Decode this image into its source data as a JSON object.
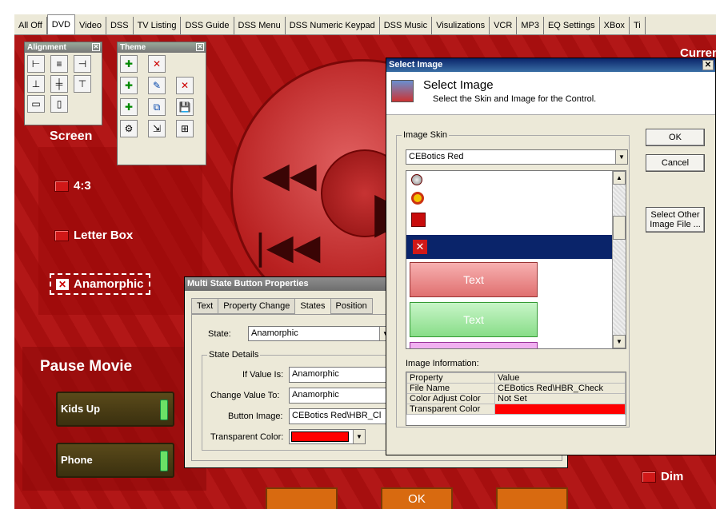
{
  "tabs": [
    "All Off",
    "DVD",
    "Video",
    "DSS",
    "TV Listing",
    "DSS Guide",
    "DSS Menu",
    "DSS Numeric Keypad",
    "DSS Music",
    "Visulizations",
    "VCR",
    "MP3",
    "EQ Settings",
    "XBox",
    "Ti"
  ],
  "active_tab": "DVD",
  "canvas": {
    "screen_label": "Screen",
    "option_43": "4:3",
    "option_letterbox": "Letter Box",
    "option_anamorphic": "Anamorphic",
    "pause_movie": "Pause Movie",
    "kids_up": "Kids Up",
    "phone": "Phone",
    "current_time_label": "Current Ti",
    "dim": "Dim",
    "ok": "OK"
  },
  "alignment_window": {
    "title": "Alignment"
  },
  "theme_window": {
    "title": "Theme"
  },
  "select_image_dialog": {
    "title": "Select Image",
    "header_title": "Select Image",
    "header_subtitle": "Select the Skin and Image for the Control.",
    "image_skin_label": "Image Skin",
    "skin_value": "CEBotics Red",
    "ok": "OK",
    "cancel": "Cancel",
    "select_other": "Select Other Image File ...",
    "preview_text1": "Text",
    "preview_text2": "Text",
    "image_info_label": "Image Information:",
    "table_headers": [
      "Property",
      "Value"
    ],
    "rows": [
      {
        "property": "File Name",
        "value": "CEBotics Red\\HBR_Check"
      },
      {
        "property": "Color Adjust Color",
        "value": "Not Set"
      },
      {
        "property": "Transparent Color",
        "value": ""
      }
    ],
    "transparent_color": "#ff0000"
  },
  "msb_dialog": {
    "title": "Multi State Button Properties",
    "tabs": [
      "Text",
      "Property Change",
      "States",
      "Position"
    ],
    "active_tab": "States",
    "state_label": "State:",
    "state_value": "Anamorphic",
    "state_details_label": "State Details",
    "if_value_label": "If Value Is:",
    "if_value": "Anamorphic",
    "change_value_label": "Change Value To:",
    "change_value": "Anamorphic",
    "button_image_label": "Button Image:",
    "button_image": "CEBotics Red\\HBR_Cl",
    "transparent_color_label": "Transparent Color:",
    "transparent_color": "#ff0000"
  }
}
